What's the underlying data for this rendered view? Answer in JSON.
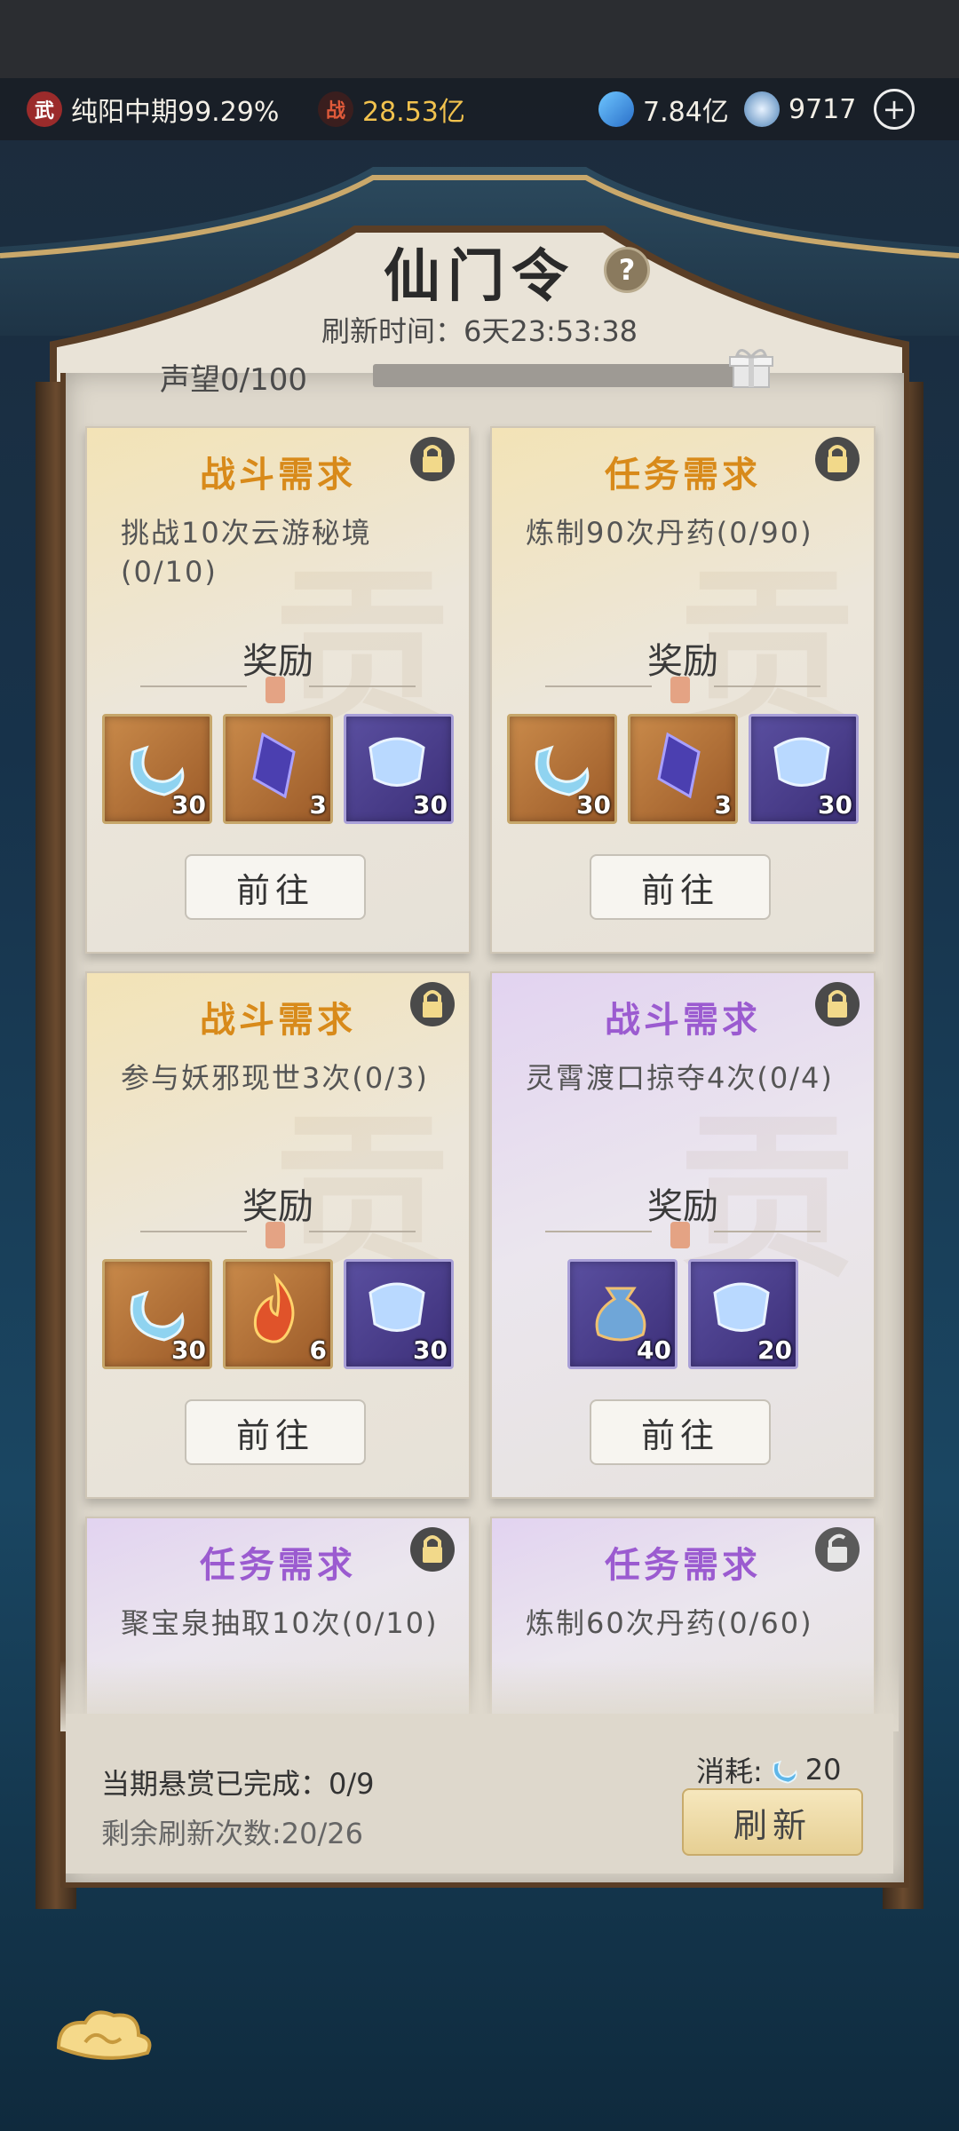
{
  "topbar": {
    "realm_badge": "武",
    "realm": "纯阳中期99.29%",
    "power_badge": "战",
    "power": "28.53亿",
    "currency1": "7.84亿",
    "currency2": "9717",
    "plus": "+"
  },
  "header": {
    "title": "仙门令",
    "help": "?",
    "refresh_time": "刷新时间：6天23:53:38",
    "prestige": "声望0/100",
    "prestige_progress": 0
  },
  "cards": [
    {
      "title": "战斗需求",
      "task": "挑战10次云游秘境(0/10)",
      "reward_label": "奖励",
      "goto": "前往",
      "items": [
        {
          "icon": "crescent-jade-icon",
          "qty": "30"
        },
        {
          "icon": "purple-crystal-icon",
          "qty": "3"
        },
        {
          "icon": "scroll-token-icon",
          "qty": "30"
        }
      ]
    },
    {
      "title": "任务需求",
      "task": "炼制90次丹药(0/90)",
      "reward_label": "奖励",
      "goto": "前往",
      "items": [
        {
          "icon": "crescent-jade-icon",
          "qty": "30"
        },
        {
          "icon": "purple-crystal-icon",
          "qty": "3"
        },
        {
          "icon": "scroll-token-icon",
          "qty": "30"
        }
      ]
    },
    {
      "title": "战斗需求",
      "task": "参与妖邪现世3次(0/3)",
      "reward_label": "奖励",
      "goto": "前往",
      "items": [
        {
          "icon": "crescent-jade-icon",
          "qty": "30"
        },
        {
          "icon": "flame-icon",
          "qty": "6"
        },
        {
          "icon": "scroll-token-icon",
          "qty": "30"
        }
      ]
    },
    {
      "title": "战斗需求",
      "task": "灵霄渡口掠夺4次(0/4)",
      "reward_label": "奖励",
      "goto": "前往",
      "items": [
        {
          "icon": "treasure-bag-icon",
          "qty": "40"
        },
        {
          "icon": "scroll-token-icon",
          "qty": "20"
        }
      ]
    },
    {
      "title": "任务需求",
      "task": "聚宝泉抽取10次(0/10)"
    },
    {
      "title": "任务需求",
      "task": "炼制60次丹药(0/60)"
    }
  ],
  "footer": {
    "completed": "当期悬赏已完成：0/9",
    "remaining": "剩余刷新次数:20/26",
    "cost_label": "消耗:",
    "cost_value": "20",
    "refresh": "刷新"
  },
  "colors": {
    "orange_title": "#d88a1a",
    "purple_title": "#9b5bd0",
    "board": "#ded8cc"
  }
}
